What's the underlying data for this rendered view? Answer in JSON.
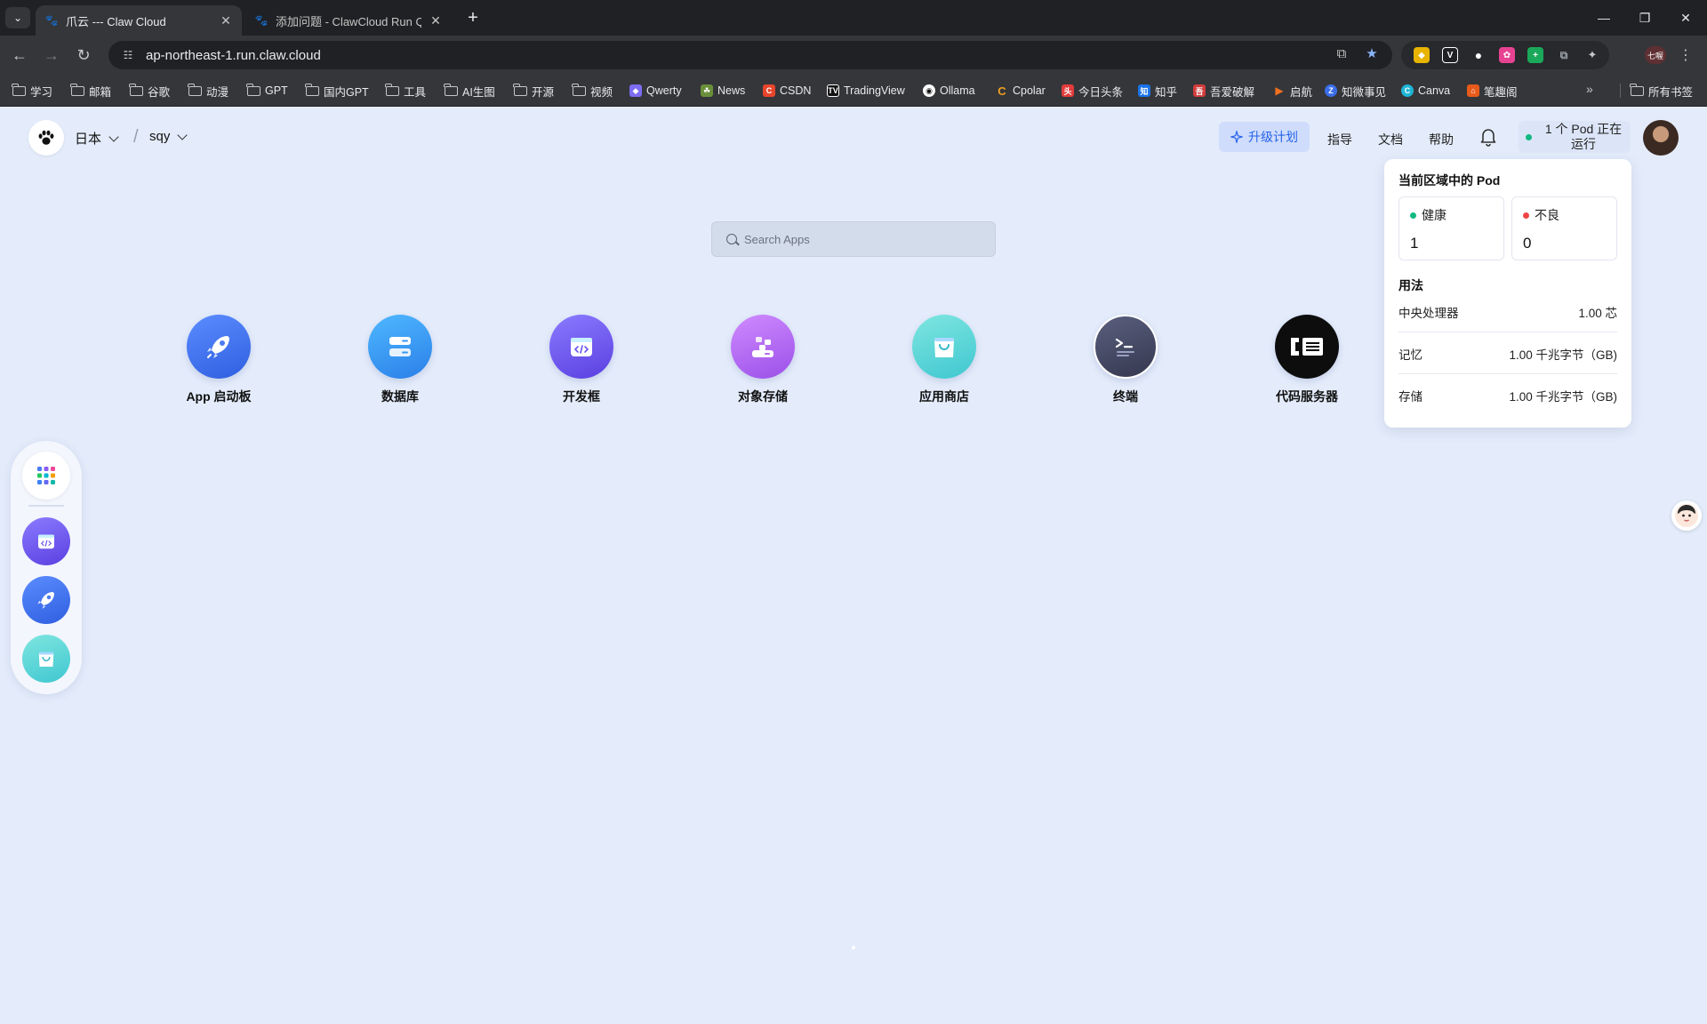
{
  "browser": {
    "tabs": [
      {
        "title": "爪云 --- Claw Cloud",
        "active": true
      },
      {
        "title": "添加问题 - ClawCloud Run Qu",
        "active": false
      }
    ],
    "url": "ap-northeast-1.run.claw.cloud",
    "profile_label": "七喔",
    "bookmarks": [
      {
        "label": "学习",
        "type": "folder"
      },
      {
        "label": "邮箱",
        "type": "folder"
      },
      {
        "label": "谷歌",
        "type": "folder"
      },
      {
        "label": "动漫",
        "type": "folder"
      },
      {
        "label": "GPT",
        "type": "folder"
      },
      {
        "label": "国内GPT",
        "type": "folder"
      },
      {
        "label": "工具",
        "type": "folder"
      },
      {
        "label": "AI生图",
        "type": "folder"
      },
      {
        "label": "开源",
        "type": "folder"
      },
      {
        "label": "视频",
        "type": "folder"
      },
      {
        "label": "Qwerty",
        "type": "site",
        "color": "#7c6cf2"
      },
      {
        "label": "News",
        "type": "site",
        "color": "#6a8f3a"
      },
      {
        "label": "CSDN",
        "type": "site",
        "color": "#e8452c"
      },
      {
        "label": "TradingView",
        "type": "site",
        "color": "#111111"
      },
      {
        "label": "Ollama",
        "type": "site",
        "color": "#ffffff"
      },
      {
        "label": "Cpolar",
        "type": "site",
        "color": "#f0a020"
      },
      {
        "label": "今日头条",
        "type": "site",
        "color": "#e33b3b"
      },
      {
        "label": "知乎",
        "type": "site",
        "color": "#1a73e8"
      },
      {
        "label": "吾爱破解",
        "type": "site",
        "color": "#d23c3c"
      },
      {
        "label": "启航",
        "type": "site",
        "color": "#f07020"
      },
      {
        "label": "知微事见",
        "type": "site",
        "color": "#3a6ee8"
      },
      {
        "label": "Canva",
        "type": "site",
        "color": "#1fb6d6"
      },
      {
        "label": "笔趣阁",
        "type": "site",
        "color": "#e85a1a"
      }
    ],
    "all_bookmarks": "所有书签"
  },
  "header": {
    "region": "日本",
    "workspace": "sqy",
    "upgrade": "升级计划",
    "guide": "指导",
    "docs": "文档",
    "help": "帮助",
    "pod_status": "1 个 Pod 正在运行"
  },
  "pod_panel": {
    "title": "当前区域中的 Pod",
    "healthy_label": "健康",
    "healthy_count": "1",
    "unhealthy_label": "不良",
    "unhealthy_count": "0",
    "usage_title": "用法",
    "usage": [
      {
        "label": "中央处理器",
        "value": "1.00 芯"
      },
      {
        "label": "记忆",
        "value": "1.00 千兆字节（GB)"
      },
      {
        "label": "存储",
        "value": "1.00 千兆字节（GB)"
      }
    ]
  },
  "search": {
    "placeholder": "Search Apps"
  },
  "apps": [
    {
      "name": "App 启动板",
      "icon": "rocket-icon"
    },
    {
      "name": "数据库",
      "icon": "database-icon"
    },
    {
      "name": "开发框",
      "icon": "devbox-icon"
    },
    {
      "name": "对象存储",
      "icon": "object-storage-icon"
    },
    {
      "name": "应用商店",
      "icon": "app-store-icon"
    },
    {
      "name": "终端",
      "icon": "terminal-icon"
    },
    {
      "name": "代码服务器",
      "icon": "code-server-icon"
    }
  ],
  "colors": {
    "accent": "#2563eb",
    "healthy": "#10b981",
    "unhealthy": "#ef4444",
    "page_bg": "#e4ecfb"
  }
}
